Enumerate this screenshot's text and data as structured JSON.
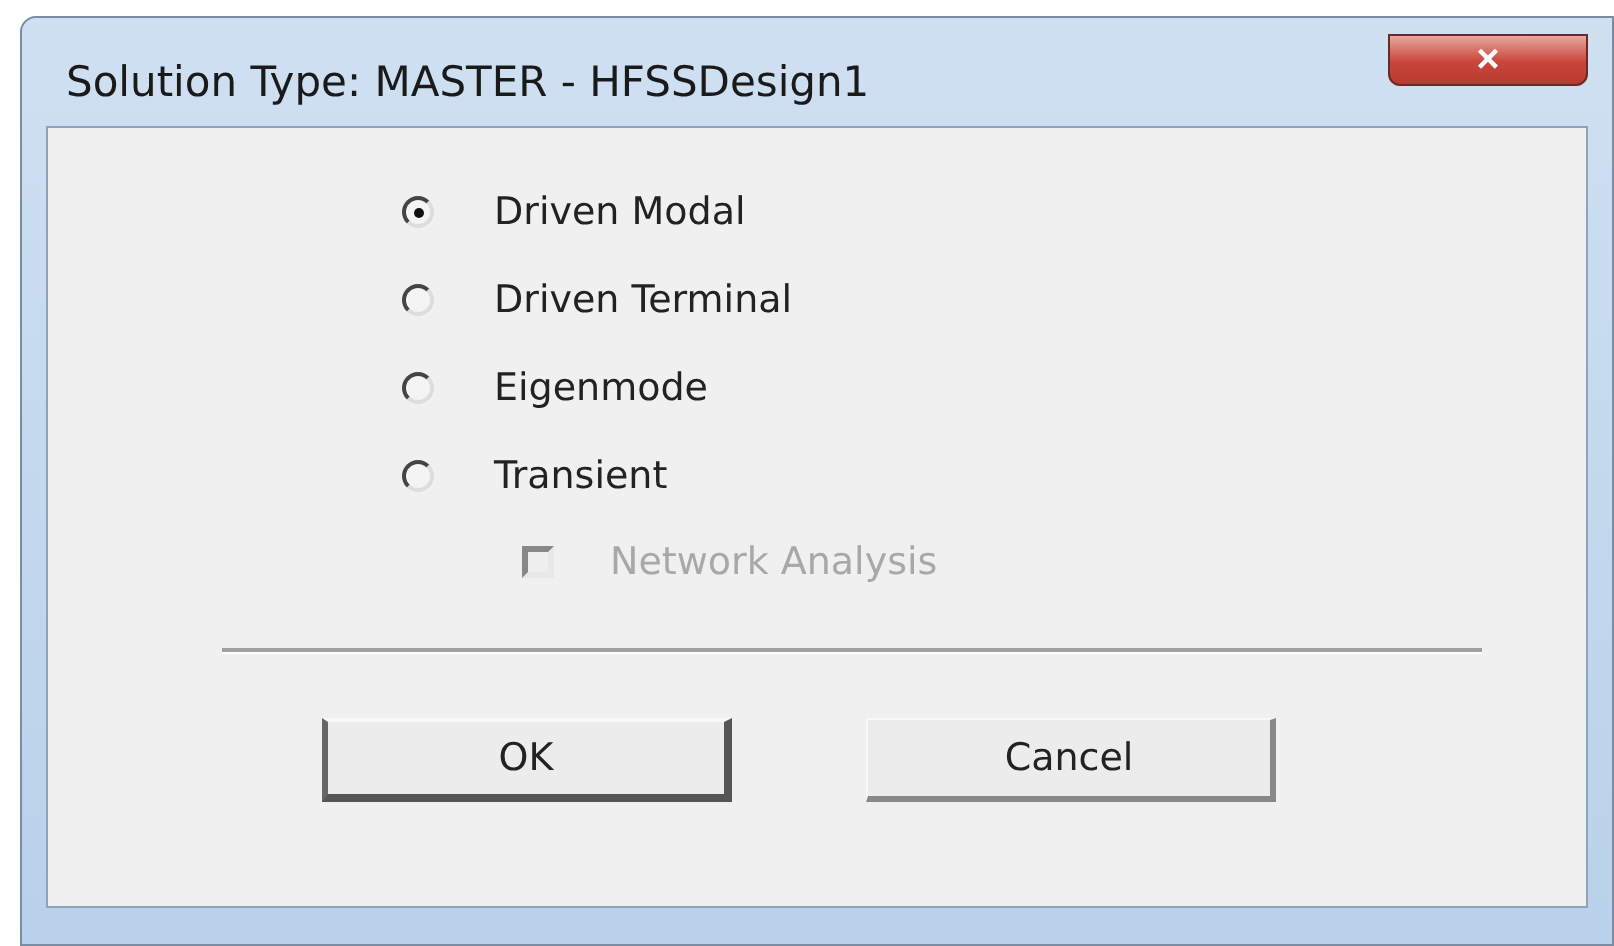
{
  "window": {
    "title": "Solution Type: MASTER - HFSSDesign1",
    "close_button": "×"
  },
  "options": [
    {
      "label": "Driven Modal",
      "selected": true
    },
    {
      "label": "Driven Terminal",
      "selected": false
    },
    {
      "label": "Eigenmode",
      "selected": false
    },
    {
      "label": "Transient",
      "selected": false
    }
  ],
  "network_analysis": {
    "label": "Network Analysis",
    "checked": false,
    "disabled": true
  },
  "buttons": [
    {
      "label": "OK",
      "default": true
    },
    {
      "label": "Cancel",
      "default": false
    }
  ]
}
